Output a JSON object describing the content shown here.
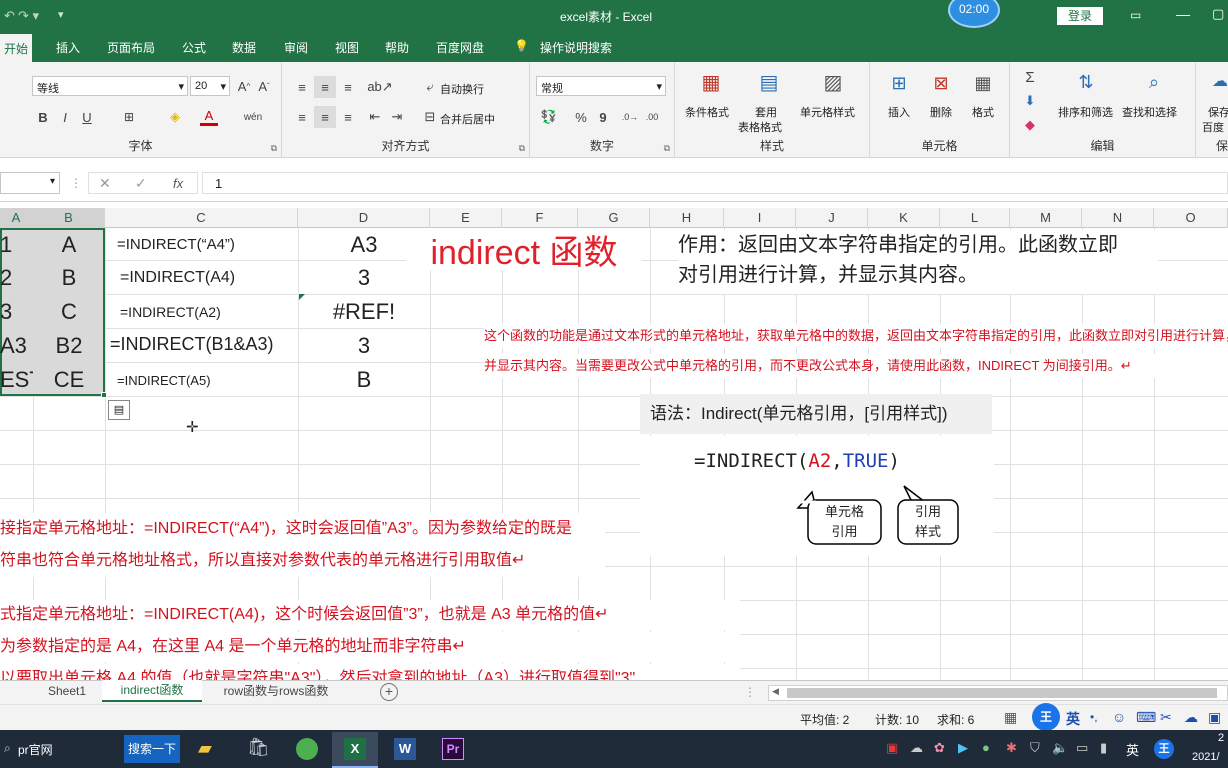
{
  "window": {
    "title": "excel素材  -  Excel",
    "clock": "02:00",
    "login": "登录"
  },
  "tabs": [
    {
      "label": "开始"
    },
    {
      "label": "插入"
    },
    {
      "label": "页面布局"
    },
    {
      "label": "公式"
    },
    {
      "label": "数据"
    },
    {
      "label": "审阅"
    },
    {
      "label": "视图"
    },
    {
      "label": "帮助"
    },
    {
      "label": "百度网盘"
    },
    {
      "label": "操作说明搜索"
    }
  ],
  "ribbon": {
    "font_name": "等线",
    "font_size": "20",
    "font_group": "字体",
    "wrap": "自动换行",
    "merge": "合并后居中",
    "align_group": "对齐方式",
    "num_format": "常规",
    "num_group": "数字",
    "cond_format": "条件格式",
    "table_format_1": "套用",
    "table_format_2": "表格格式",
    "cell_style": "单元格样式",
    "style_group": "样式",
    "insert": "插入",
    "delete": "删除",
    "format": "格式",
    "cells_group": "单元格",
    "sort_filter": "排序和筛选",
    "find_select": "查找和选择",
    "edit_group": "编辑",
    "save_1": "保存",
    "save_2": "百度",
    "save_group": "保"
  },
  "formula_bar": {
    "value": "1",
    "fx": "fx"
  },
  "columns": [
    "A",
    "B",
    "C",
    "D",
    "E",
    "F",
    "G",
    "H",
    "I",
    "J",
    "K",
    "L",
    "M",
    "N",
    "O"
  ],
  "rows": [
    {
      "a": "1",
      "b": "A",
      "c": "=INDIRECT(“A4”)",
      "d": "A3"
    },
    {
      "a": "2",
      "b": "B",
      "c": "=INDIRECT(A4)",
      "d": "3"
    },
    {
      "a": "3",
      "b": "C",
      "c": "=INDIRECT(A2)",
      "d": "#REF!"
    },
    {
      "a": "A3",
      "b": "B2",
      "c": "=INDIRECT(B1&A3)",
      "d": "3"
    },
    {
      "a": "EST",
      "b": "CE",
      "c": "=INDIRECT(A5)",
      "d": "B"
    }
  ],
  "annotations": {
    "title": "indirect 函数",
    "purpose_1": "作用：返回由文本字符串指定的引用。此函数立即",
    "purpose_2": "对引用进行计算，并显示其内容。",
    "desc_1": "这个函数的功能是通过文本形式的单元格地址，获取单元格中的数据，返回由文本字符串指定的引用，此函数立即对引用进行计算，",
    "desc_2": "并显示其内容。当需要更改公式中单元格的引用，而不更改公式本身，请使用此函数，INDIRECT 为间接引用。↵",
    "syntax": "语法：Indirect(单元格引用，[引用样式])",
    "example_prefix": "=INDIRECT(",
    "example_arg1": "A2",
    "example_comma": ",",
    "example_arg2": "TRUE",
    "example_suffix": ")",
    "bubble1_1": "单元格",
    "bubble1_2": "引用",
    "bubble2_1": "引用",
    "bubble2_2": "样式",
    "note1_1": "接指定单元格地址：=INDIRECT(“A4”)，这时会返回值”A3”。因为参数给定的既是",
    "note1_2": "符串也符合单元格地址格式，所以直接对参数代表的单元格进行引用取值↵",
    "note2_1": "式指定单元格地址：=INDIRECT(A4)，这个时候会返回值”3”，也就是 A3 单元格的值↵",
    "note2_2": "为参数指定的是 A4，在这里 A4 是一个单元格的地址而非字符串↵",
    "note2_3": "以要取出单元格 A4 的值（也就是字符串\"A3\"），然后对拿到的地址（A3）进行取值得到\"3\""
  },
  "sheets": [
    {
      "label": "Sheet1"
    },
    {
      "label": "indirect函数"
    },
    {
      "label": "row函数与rows函数"
    }
  ],
  "status": {
    "avg": "平均值: 2",
    "count": "计数: 10",
    "sum": "求和: 6",
    "ime": "英"
  },
  "taskbar": {
    "item": "pr官网",
    "search": "搜索一下",
    "time": "2",
    "date": "2021/",
    "ime": "英"
  }
}
